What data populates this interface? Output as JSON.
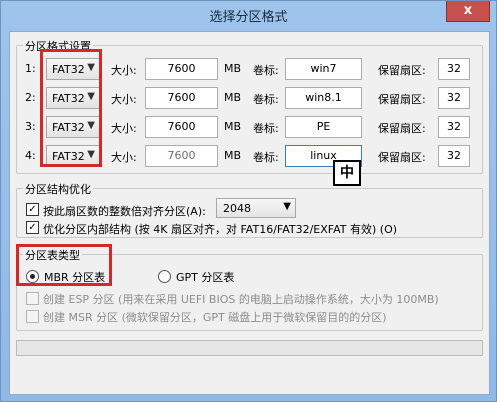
{
  "window": {
    "title": "选择分区格式",
    "close_label": "x"
  },
  "format_group": {
    "title": "分区格式设置",
    "rows": [
      {
        "index": "1:",
        "fs": "FAT32",
        "size_label": "大小:",
        "size": "7600",
        "unit": "MB",
        "vol_label": "卷标:",
        "volume": "win7",
        "reserve_label": "保留扇区:",
        "reserve": "32"
      },
      {
        "index": "2:",
        "fs": "FAT32",
        "size_label": "大小:",
        "size": "7600",
        "unit": "MB",
        "vol_label": "卷标:",
        "volume": "win8.1",
        "reserve_label": "保留扇区:",
        "reserve": "32"
      },
      {
        "index": "3:",
        "fs": "FAT32",
        "size_label": "大小:",
        "size": "7600",
        "unit": "MB",
        "vol_label": "卷标:",
        "volume": "PE",
        "reserve_label": "保留扇区:",
        "reserve": "32"
      },
      {
        "index": "4:",
        "fs": "FAT32",
        "size_label": "大小:",
        "size": "7600",
        "unit": "MB",
        "vol_label": "卷标:",
        "volume": "linux",
        "reserve_label": "保留扇区:",
        "reserve": "32"
      }
    ]
  },
  "ime_indicator": "中",
  "structure_group": {
    "title": "分区结构优化",
    "align_label": "按此扇区数的整数倍对齐分区(A):",
    "align_value": "2048",
    "optimize_label": "优化分区内部结构 (按 4K 扇区对齐，对 FAT16/FAT32/EXFAT 有效) (O)"
  },
  "table_group": {
    "title": "分区表类型",
    "mbr_label": "MBR 分区表",
    "gpt_label": "GPT 分区表",
    "esp_label": "创建 ESP 分区 (用来在采用 UEFI BIOS 的电脑上启动操作系统，大小为 100MB)",
    "msr_label": "创建 MSR 分区 (微软保留分区，GPT 磁盘上用于微软保留目的的分区)"
  },
  "progress": {
    "value": 0
  },
  "colors": {
    "highlight": "#d3292b",
    "title_bar": "#9ec4ec",
    "close": "#c7504f"
  }
}
